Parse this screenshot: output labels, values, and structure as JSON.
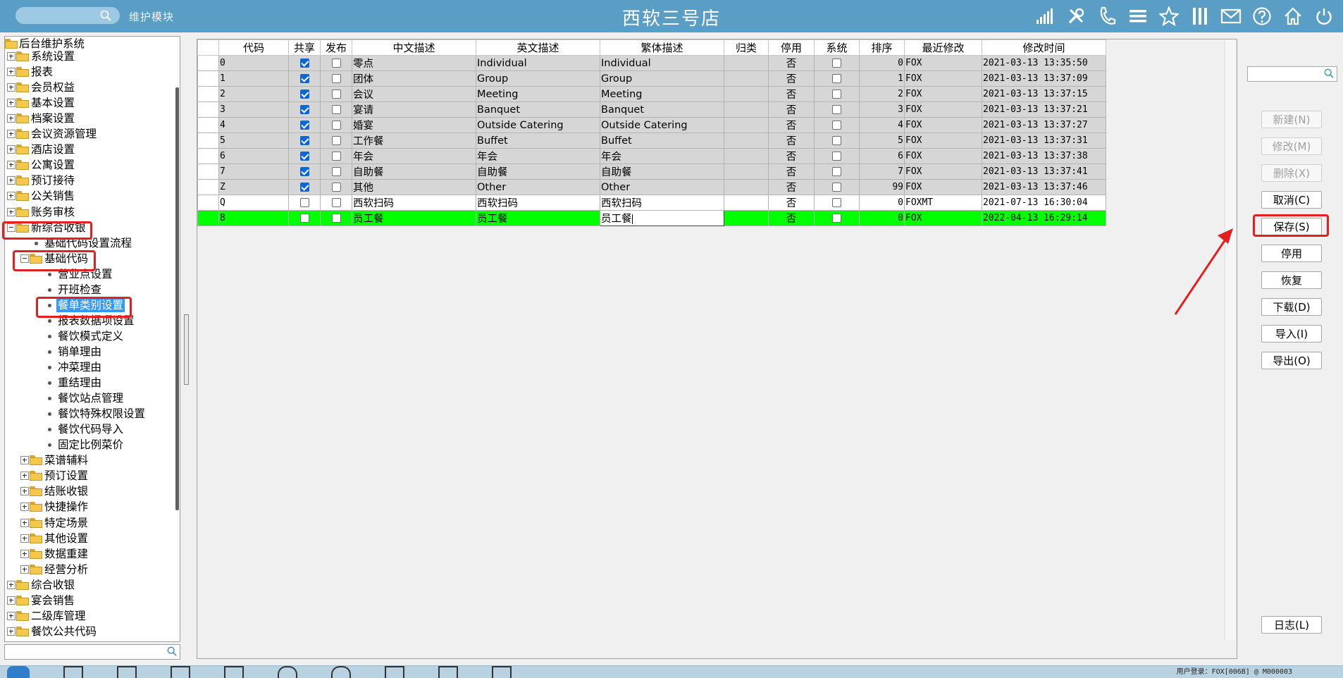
{
  "titlebar": {
    "title": "西软三号店",
    "module": "维护模块",
    "icons": [
      "signal-icon",
      "tools-icon",
      "phone-icon",
      "menu-icon",
      "star-icon",
      "columns-icon",
      "mail-icon",
      "help-icon",
      "home-icon",
      "power-icon"
    ]
  },
  "tree": {
    "root": "后台维护系统",
    "items": [
      {
        "label": "系统设置",
        "type": "folder",
        "level": 1,
        "state": "collapsed"
      },
      {
        "label": "报表",
        "type": "folder",
        "level": 1,
        "state": "collapsed"
      },
      {
        "label": "会员权益",
        "type": "folder",
        "level": 1,
        "state": "collapsed"
      },
      {
        "label": "基本设置",
        "type": "folder",
        "level": 1,
        "state": "collapsed"
      },
      {
        "label": "档案设置",
        "type": "folder",
        "level": 1,
        "state": "collapsed"
      },
      {
        "label": "会议资源管理",
        "type": "folder",
        "level": 1,
        "state": "collapsed"
      },
      {
        "label": "酒店设置",
        "type": "folder",
        "level": 1,
        "state": "collapsed"
      },
      {
        "label": "公寓设置",
        "type": "folder",
        "level": 1,
        "state": "collapsed"
      },
      {
        "label": "预订接待",
        "type": "folder",
        "level": 1,
        "state": "collapsed"
      },
      {
        "label": "公关销售",
        "type": "folder",
        "level": 1,
        "state": "collapsed"
      },
      {
        "label": "账务审核",
        "type": "folder",
        "level": 1,
        "state": "collapsed"
      },
      {
        "label": "新综合收银",
        "type": "folder",
        "level": 1,
        "state": "expanded",
        "highlight": true
      },
      {
        "label": "基础代码设置流程",
        "type": "leaf",
        "level": 2
      },
      {
        "label": "基础代码",
        "type": "folder",
        "level": 2,
        "state": "expanded",
        "highlight": true
      },
      {
        "label": "营业点设置",
        "type": "leaf",
        "level": 3
      },
      {
        "label": "开班检查",
        "type": "leaf",
        "level": 3
      },
      {
        "label": "餐单类别设置",
        "type": "leaf",
        "level": 3,
        "selected": true,
        "highlight": true
      },
      {
        "label": "报表数据项设置",
        "type": "leaf",
        "level": 3
      },
      {
        "label": "餐饮模式定义",
        "type": "leaf",
        "level": 3
      },
      {
        "label": "销单理由",
        "type": "leaf",
        "level": 3
      },
      {
        "label": "冲菜理由",
        "type": "leaf",
        "level": 3
      },
      {
        "label": "重结理由",
        "type": "leaf",
        "level": 3
      },
      {
        "label": "餐饮站点管理",
        "type": "leaf",
        "level": 3
      },
      {
        "label": "餐饮特殊权限设置",
        "type": "leaf",
        "level": 3
      },
      {
        "label": "餐饮代码导入",
        "type": "leaf",
        "level": 3
      },
      {
        "label": "固定比例菜价",
        "type": "leaf",
        "level": 3
      },
      {
        "label": "菜谱辅料",
        "type": "folder",
        "level": 2,
        "state": "collapsed"
      },
      {
        "label": "预订设置",
        "type": "folder",
        "level": 2,
        "state": "collapsed"
      },
      {
        "label": "结账收银",
        "type": "folder",
        "level": 2,
        "state": "collapsed"
      },
      {
        "label": "快捷操作",
        "type": "folder",
        "level": 2,
        "state": "collapsed"
      },
      {
        "label": "特定场景",
        "type": "folder",
        "level": 2,
        "state": "collapsed"
      },
      {
        "label": "其他设置",
        "type": "folder",
        "level": 2,
        "state": "collapsed"
      },
      {
        "label": "数据重建",
        "type": "folder",
        "level": 2,
        "state": "collapsed"
      },
      {
        "label": "经营分析",
        "type": "folder",
        "level": 2,
        "state": "collapsed"
      },
      {
        "label": "综合收银",
        "type": "folder",
        "level": 1,
        "state": "collapsed"
      },
      {
        "label": "宴会销售",
        "type": "folder",
        "level": 1,
        "state": "collapsed"
      },
      {
        "label": "二级库管理",
        "type": "folder",
        "level": 1,
        "state": "collapsed"
      },
      {
        "label": "餐饮公共代码",
        "type": "folder",
        "level": 1,
        "state": "collapsed"
      }
    ]
  },
  "grid": {
    "columns": [
      "代码",
      "共享",
      "发布",
      "中文描述",
      "英文描述",
      "繁体描述",
      "归类",
      "停用",
      "系统",
      "排序",
      "最近修改",
      "修改时间"
    ],
    "rows": [
      {
        "code": "0",
        "share": true,
        "publish": false,
        "cn": "零点",
        "en": "Individual",
        "tw": "Individual",
        "cat": "",
        "disabled": "否",
        "sys": false,
        "order": "0",
        "modifier": "FOX",
        "time": "2021-03-13 13:35:50"
      },
      {
        "code": "1",
        "share": true,
        "publish": false,
        "cn": "团体",
        "en": "Group",
        "tw": "Group",
        "cat": "",
        "disabled": "否",
        "sys": false,
        "order": "1",
        "modifier": "FOX",
        "time": "2021-03-13 13:37:09"
      },
      {
        "code": "2",
        "share": true,
        "publish": false,
        "cn": "会议",
        "en": "Meeting",
        "tw": "Meeting",
        "cat": "",
        "disabled": "否",
        "sys": false,
        "order": "2",
        "modifier": "FOX",
        "time": "2021-03-13 13:37:15"
      },
      {
        "code": "3",
        "share": true,
        "publish": false,
        "cn": "宴请",
        "en": "Banquet",
        "tw": "Banquet",
        "cat": "",
        "disabled": "否",
        "sys": false,
        "order": "3",
        "modifier": "FOX",
        "time": "2021-03-13 13:37:21"
      },
      {
        "code": "4",
        "share": true,
        "publish": false,
        "cn": "婚宴",
        "en": "Outside Catering",
        "tw": "Outside Catering",
        "cat": "",
        "disabled": "否",
        "sys": false,
        "order": "4",
        "modifier": "FOX",
        "time": "2021-03-13 13:37:27"
      },
      {
        "code": "5",
        "share": true,
        "publish": false,
        "cn": "工作餐",
        "en": "Buffet",
        "tw": "Buffet",
        "cat": "",
        "disabled": "否",
        "sys": false,
        "order": "5",
        "modifier": "FOX",
        "time": "2021-03-13 13:37:31"
      },
      {
        "code": "6",
        "share": true,
        "publish": false,
        "cn": "年会",
        "en": "年会",
        "tw": "年会",
        "cat": "",
        "disabled": "否",
        "sys": false,
        "order": "6",
        "modifier": "FOX",
        "time": "2021-03-13 13:37:38"
      },
      {
        "code": "7",
        "share": true,
        "publish": false,
        "cn": "自助餐",
        "en": "自助餐",
        "tw": "自助餐",
        "cat": "",
        "disabled": "否",
        "sys": false,
        "order": "7",
        "modifier": "FOX",
        "time": "2021-03-13 13:37:41"
      },
      {
        "code": "Z",
        "share": true,
        "publish": false,
        "cn": "其他",
        "en": "Other",
        "tw": "Other",
        "cat": "",
        "disabled": "否",
        "sys": false,
        "order": "99",
        "modifier": "FOX",
        "time": "2021-03-13 13:37:46"
      },
      {
        "code": "Q",
        "share": false,
        "publish": false,
        "cn": "西软扫码",
        "en": "西软扫码",
        "tw": "西软扫码",
        "cat": "",
        "disabled": "否",
        "sys": false,
        "order": "0",
        "modifier": "FOXMT",
        "time": "2021-07-13 16:30:04",
        "style": "white"
      },
      {
        "code": "8",
        "share": false,
        "publish": false,
        "cn": "员工餐",
        "en": "员工餐",
        "tw": "员工餐",
        "cat": "",
        "disabled": "否",
        "sys": false,
        "order": "0",
        "modifier": "FOX",
        "time": "2022-04-13 16:29:14",
        "style": "green",
        "editing": true
      }
    ]
  },
  "actions": [
    {
      "label": "新建(N)",
      "enabled": false
    },
    {
      "label": "修改(M)",
      "enabled": false
    },
    {
      "label": "删除(X)",
      "enabled": false
    },
    {
      "label": "取消(C)",
      "enabled": true
    },
    {
      "label": "保存(S)",
      "enabled": true,
      "highlight": true
    },
    {
      "label": "停用",
      "enabled": true
    },
    {
      "label": "恢复",
      "enabled": true
    },
    {
      "label": "下载(D)",
      "enabled": true
    },
    {
      "label": "导入(I)",
      "enabled": true
    },
    {
      "label": "导出(O)",
      "enabled": true
    }
  ],
  "log_button": "日志(L)",
  "statusbar": {
    "user": "用户登录：FOX[006B] @ M000003"
  },
  "colors": {
    "titlebar": "#5a9ec6",
    "highlight": "#e41f1f",
    "selected_row": "#00ff00",
    "selection": "#3399ff"
  }
}
